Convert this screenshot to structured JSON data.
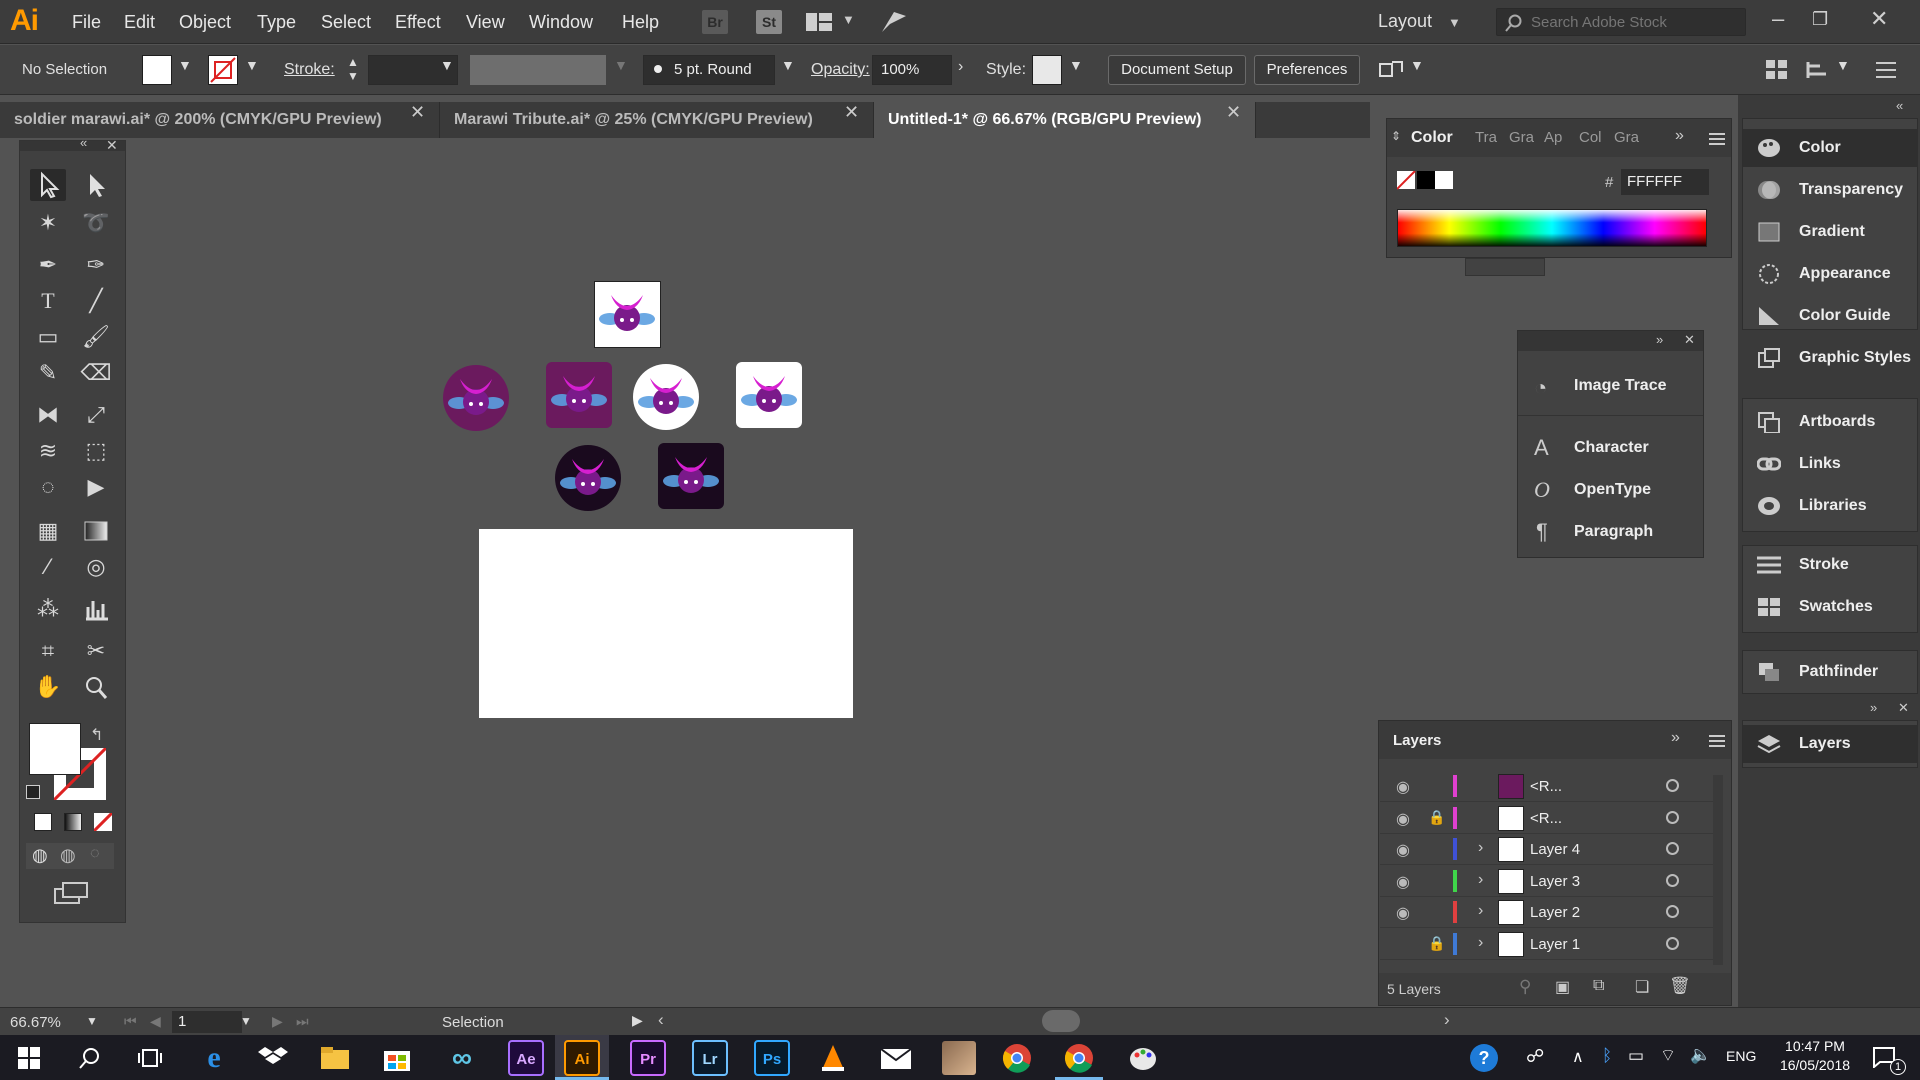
{
  "app": {
    "logo": "Ai",
    "menu": [
      "File",
      "Edit",
      "Object",
      "Type",
      "Select",
      "Effect",
      "View",
      "Window",
      "Help"
    ],
    "bridge_badge": "Br",
    "stock_badge": "St",
    "workspace": "Layout",
    "search_placeholder": "Search Adobe Stock"
  },
  "control_bar": {
    "selection_label": "No Selection",
    "stroke_label": "Stroke:",
    "brush": "5 pt. Round",
    "opacity_label": "Opacity:",
    "opacity_value": "100%",
    "style_label": "Style:",
    "document_setup": "Document Setup",
    "preferences": "Preferences"
  },
  "tabs": [
    {
      "label": "soldier marawi.ai* @ 200% (CMYK/GPU Preview)",
      "active": false
    },
    {
      "label": "Marawi Tribute.ai* @ 25% (CMYK/GPU Preview)",
      "active": false
    },
    {
      "label": "Untitled-1* @ 66.67% (RGB/GPU Preview)",
      "active": true
    }
  ],
  "color_panel": {
    "title": "Color",
    "other_tabs": [
      "Tra",
      "Gra",
      "Ap",
      "Col",
      "Gra"
    ],
    "hex_label": "#",
    "hex_value": "FFFFFF"
  },
  "floating_panel": {
    "items": [
      "Image Trace",
      "Character",
      "OpenType",
      "Paragraph"
    ]
  },
  "dock": {
    "group1": [
      "Color",
      "Transparency",
      "Gradient",
      "Appearance",
      "Color Guide",
      "Graphic Styles"
    ],
    "group2": [
      "Artboards",
      "Links",
      "Libraries"
    ],
    "group3": [
      "Stroke",
      "Swatches"
    ],
    "group4": [
      "Pathfinder"
    ],
    "group5": [
      "Layers"
    ]
  },
  "layers_panel": {
    "title": "Layers",
    "rows": [
      {
        "name": "<R...",
        "color": "#e040d0",
        "thumb": "#6b1a5e",
        "locked": false,
        "expandable": false
      },
      {
        "name": "<R...",
        "color": "#e040d0",
        "thumb": "#ffffff",
        "locked": true,
        "expandable": false
      },
      {
        "name": "Layer 4",
        "color": "#3f51d6",
        "thumb": "#ffffff",
        "locked": false,
        "expandable": true
      },
      {
        "name": "Layer 3",
        "color": "#3fd64a",
        "thumb": "#ffffff",
        "locked": false,
        "expandable": true
      },
      {
        "name": "Layer 2",
        "color": "#e04040",
        "thumb": "#ffffff",
        "locked": false,
        "expandable": true
      },
      {
        "name": "Layer 1",
        "color": "#3f7ad6",
        "thumb": "#ffffff",
        "locked": true,
        "expandable": true
      }
    ],
    "count": "5 Layers"
  },
  "status": {
    "zoom": "66.67%",
    "artboard": "1",
    "tool": "Selection"
  },
  "taskbar": {
    "apps": [
      "Ae",
      "Ai",
      "Pr",
      "Lr",
      "Ps"
    ],
    "language": "ENG",
    "time": "10:47 PM",
    "date": "16/05/2018",
    "notification_count": "1"
  },
  "colors": {
    "magenta": "#d61fd0",
    "purple_dark": "#6b1a5e",
    "wing_blue": "#5b9ee0"
  }
}
